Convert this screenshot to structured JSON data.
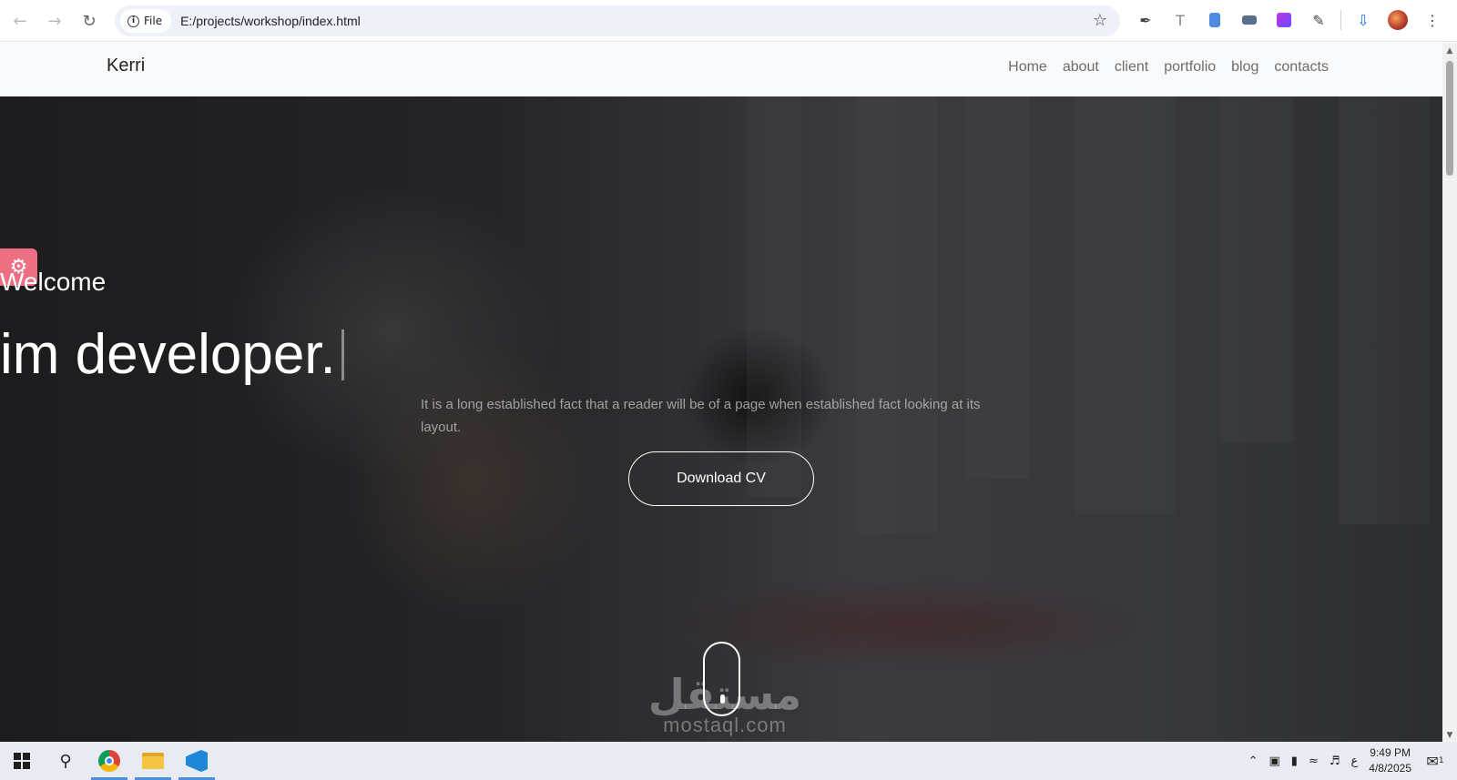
{
  "browser": {
    "site_chip": "File",
    "url": "E:/projects/workshop/index.html"
  },
  "site": {
    "brand": "Kerri",
    "menu": [
      "Home",
      "about",
      "client",
      "portfolio",
      "blog",
      "contacts"
    ]
  },
  "hero": {
    "welcome": "Welcome",
    "headline": "im developer.",
    "description": "It is a long established fact that a reader will be of a page when established fact looking at its layout.",
    "cta": "Download CV"
  },
  "watermark": {
    "arabic": "مستقل",
    "latin": "mostaql.com"
  },
  "taskbar": {
    "input_indicator": "ع",
    "time": "9:49 PM",
    "date": "4/8/2025",
    "notification_count": "1"
  },
  "colors": {
    "settings_tab": "#ec6f83",
    "header_bg": "#f8f9fa",
    "taskbar_bg": "#e8ecf2"
  }
}
